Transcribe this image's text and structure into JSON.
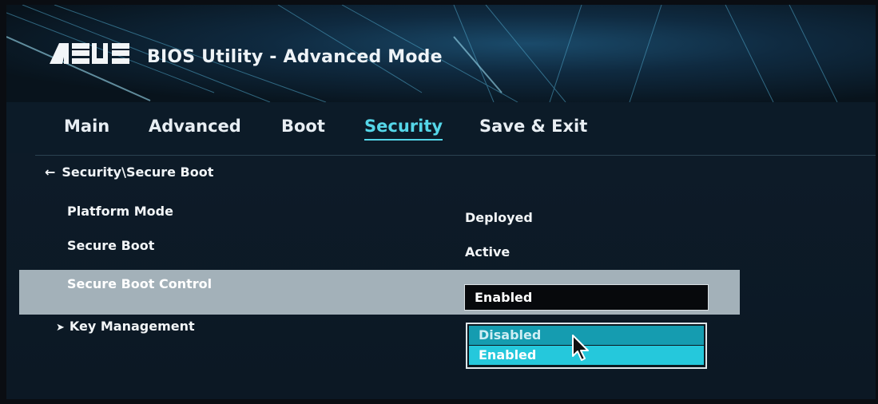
{
  "header": {
    "title": "BIOS Utility - Advanced Mode"
  },
  "tabs": [
    {
      "label": "Main",
      "active": false
    },
    {
      "label": "Advanced",
      "active": false
    },
    {
      "label": "Boot",
      "active": false
    },
    {
      "label": "Security",
      "active": true
    },
    {
      "label": "Save & Exit",
      "active": false
    }
  ],
  "breadcrumb": {
    "text": "Security\\Secure Boot"
  },
  "settings": [
    {
      "label": "Platform Mode",
      "value": "Deployed"
    },
    {
      "label": "Secure Boot",
      "value": "Active"
    },
    {
      "label": "Secure Boot Control",
      "value": "Enabled"
    }
  ],
  "submenu": {
    "label": "Key Management"
  },
  "dropdown": {
    "options": [
      "Disabled",
      "Enabled"
    ],
    "selected": "Enabled"
  },
  "colors": {
    "accent": "#55d6e8",
    "highlight": "#25c8dc",
    "row_highlight": "#a3b1b9"
  }
}
